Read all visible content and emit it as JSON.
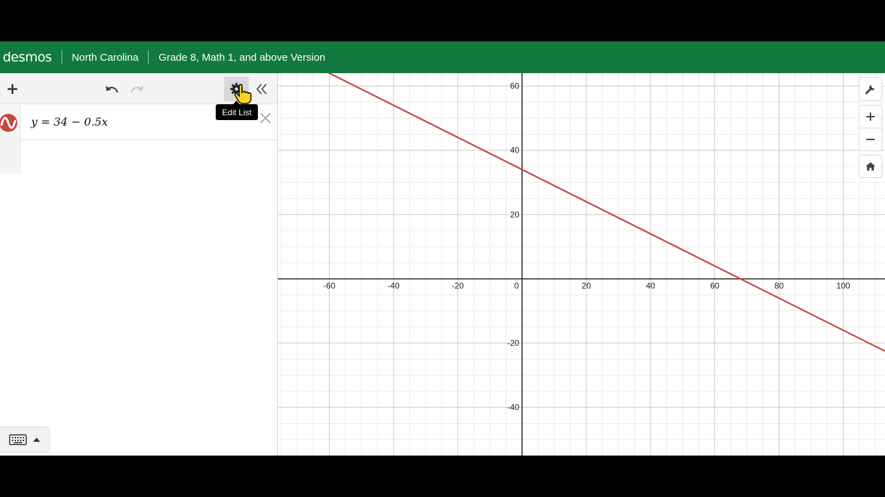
{
  "header": {
    "logo": "desmos",
    "region": "North Carolina",
    "version": "Grade 8, Math 1, and above Version",
    "bg_color": "#127a3e"
  },
  "toolbar": {
    "add_icon": "plus-icon",
    "undo_icon": "undo-icon",
    "redo_icon": "redo-icon",
    "settings_icon": "gear-icon",
    "collapse_icon": "double-chevron-left-icon",
    "tooltip": "Edit List"
  },
  "expressions": [
    {
      "latex_display": "y = 34 − 0.5x",
      "color": "#c74440",
      "slope": -0.5,
      "intercept": 34
    }
  ],
  "graph": {
    "x_range": [
      -76,
      113
    ],
    "y_range": [
      -55,
      64
    ],
    "grid_major": 20,
    "grid_minor": 4,
    "x_tick_labels": [
      "-60",
      "-40",
      "-20",
      "0",
      "20",
      "40",
      "60",
      "80",
      "100"
    ],
    "y_tick_labels": [
      "60",
      "40",
      "20",
      "-20",
      "-40"
    ],
    "tools": [
      "wrench-icon",
      "zoom-in-icon",
      "zoom-out-icon",
      "home-icon"
    ]
  }
}
